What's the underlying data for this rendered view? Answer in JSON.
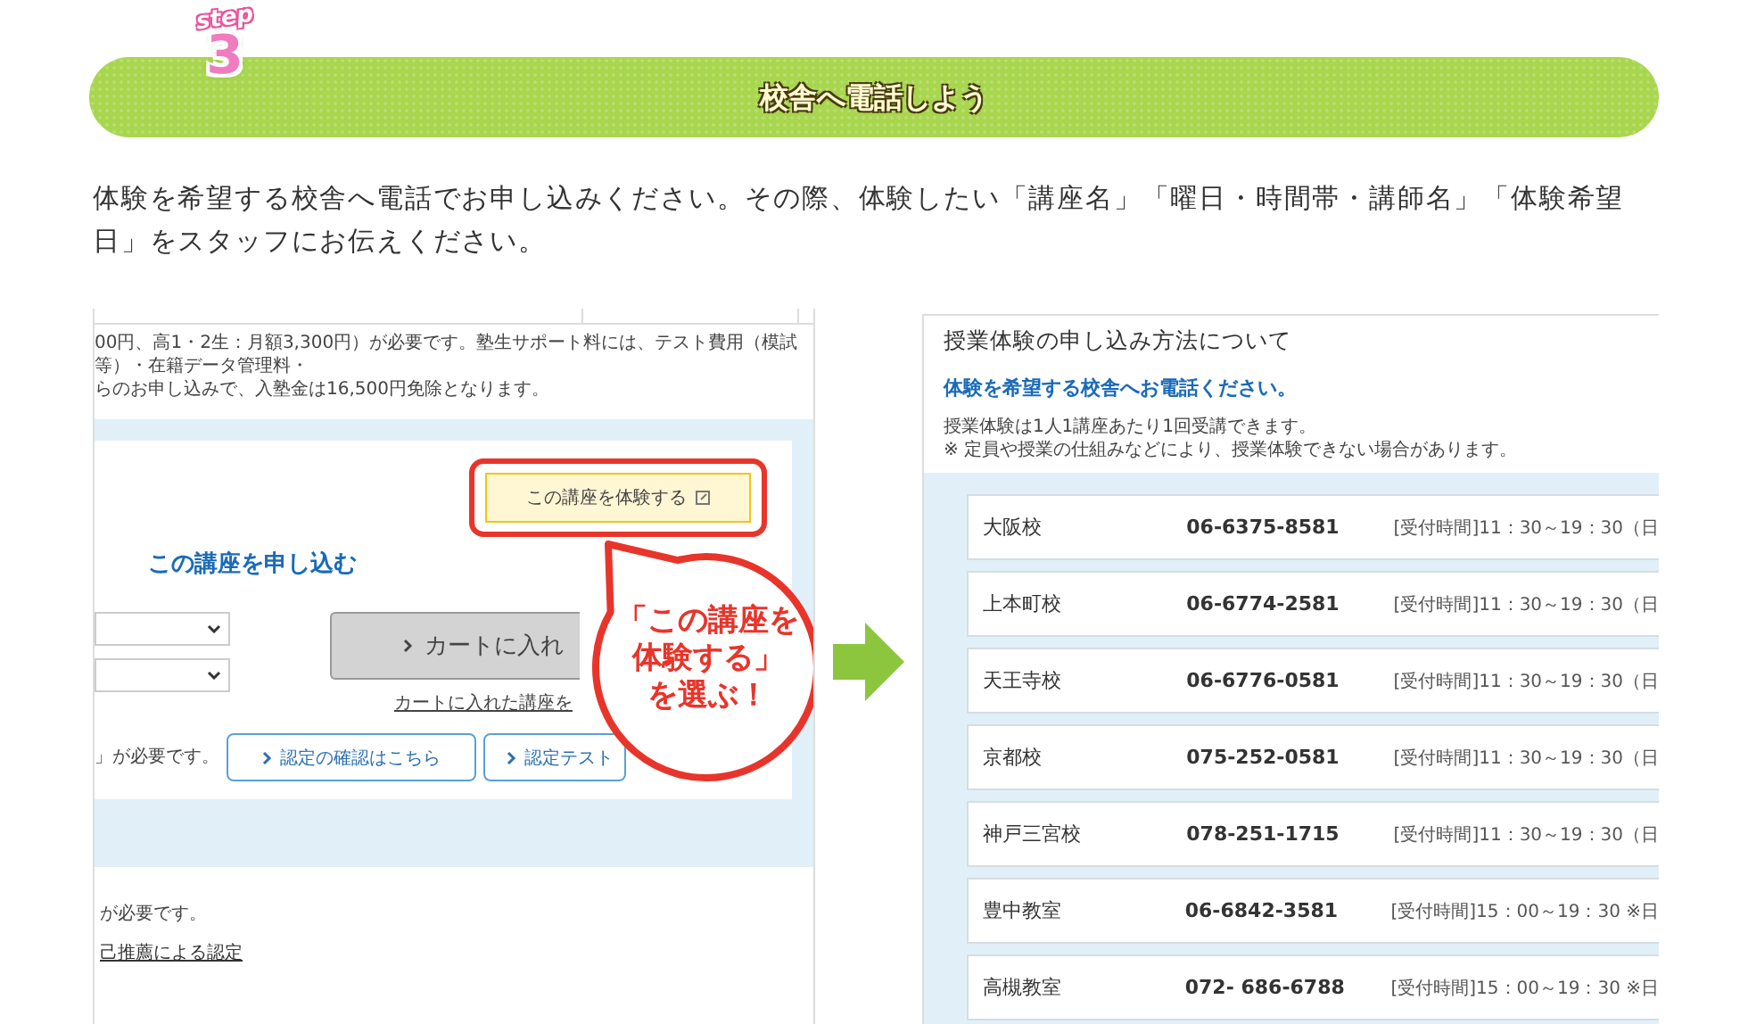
{
  "header": {
    "step_label": "step",
    "step_number": "3",
    "title": "校舎へ電話しよう"
  },
  "intro": "体験を希望する校舎へ電話でお申し込みください。その際、体験したい「講座名」「曜日・時間帯・講師名」「体験希望日」をスタッフにお伝えください。",
  "left_screenshot": {
    "notes": [
      "00円、高1・2生：月額3,300円）が必要です。塾生サポート料には、テスト費用（模試等）・在籍データ管理料・",
      "らのお申し込みで、入塾金は16,500円免除となります。"
    ],
    "trial_button": "この講座を体験する",
    "apply_heading": "この講座を申し込む",
    "cart_button": "カートに入れ",
    "cart_link": "カートに入れた講座を",
    "requirement_text": "」が必要です。",
    "buttons": [
      "認定の確認はこちら",
      "認定テスト"
    ],
    "footer_text": "が必要です。",
    "footer_link": "己推薦による認定",
    "callout_lines": [
      "「この講座を",
      "体験する」",
      "を選ぶ！"
    ]
  },
  "right_screenshot": {
    "title": "授業体験の申し込み方法について",
    "lead": "体験を希望する校舎へお電話ください。",
    "notes": [
      "授業体験は1人1講座あたり1回受講できます。",
      "※ 定員や授業の仕組みなどにより、授業体験できない場合があります。"
    ],
    "schools": [
      {
        "name": "大阪校",
        "phone": "06-6375-8581",
        "hours": "[受付時間]11：30～19：30（日"
      },
      {
        "name": "上本町校",
        "phone": "06-6774-2581",
        "hours": "[受付時間]11：30～19：30（日"
      },
      {
        "name": "天王寺校",
        "phone": "06-6776-0581",
        "hours": "[受付時間]11：30～19：30（日"
      },
      {
        "name": "京都校",
        "phone": "075-252-0581",
        "hours": "[受付時間]11：30～19：30（日"
      },
      {
        "name": "神戸三宮校",
        "phone": "078-251-1715",
        "hours": "[受付時間]11：30～19：30（日"
      },
      {
        "name": "豊中教室",
        "phone": "06-6842-3581",
        "hours": "[受付時間]15：00～19：30 ※日"
      },
      {
        "name": "高槻教室",
        "phone": "072- 686-6788",
        "hours": "[受付時間]15：00～19：30 ※日"
      }
    ]
  }
}
